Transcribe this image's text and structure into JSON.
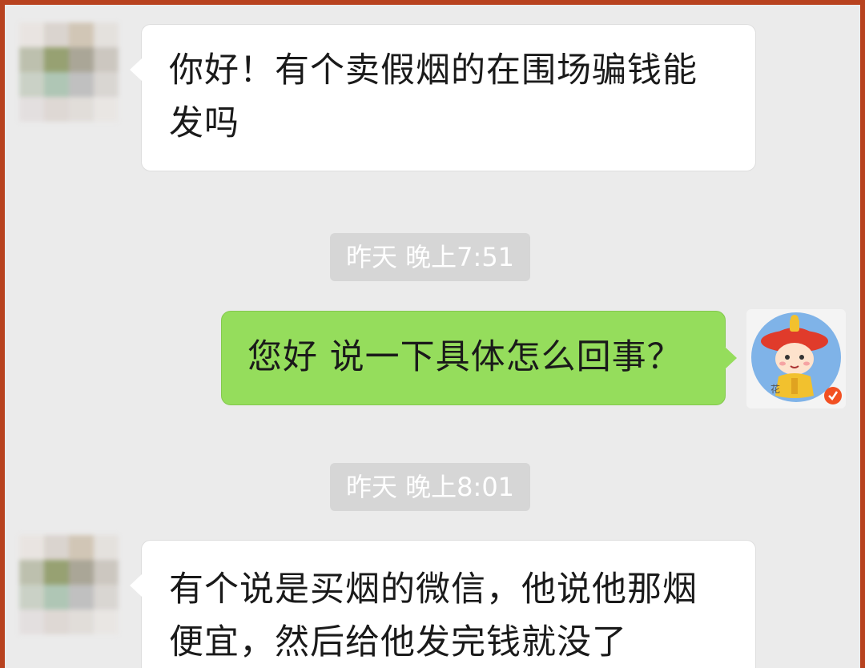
{
  "colors": {
    "frame": "#b8421f",
    "background": "#ebebeb",
    "incoming_bubble": "#ffffff",
    "outgoing_bubble": "#95dd5c",
    "timestamp_bg": "#d6d6d6"
  },
  "messages": [
    {
      "direction": "incoming",
      "text_line1": "你好！有个卖假烟的在围场骗钱能",
      "text_line2": "发吗"
    },
    {
      "direction": "timestamp",
      "text": "昨天 晚上7:51"
    },
    {
      "direction": "outgoing",
      "text": "您好 说一下具体怎么回事？"
    },
    {
      "direction": "timestamp",
      "text": "昨天 晚上8:01"
    },
    {
      "direction": "incoming",
      "text_line1": "有个说是买烟的微信，他说他那烟",
      "text_line2": "便宜，然后给他发完钱就没了"
    }
  ],
  "avatars": {
    "contact": "blurred-avatar-icon",
    "self": "emperor-cartoon-avatar-icon"
  }
}
